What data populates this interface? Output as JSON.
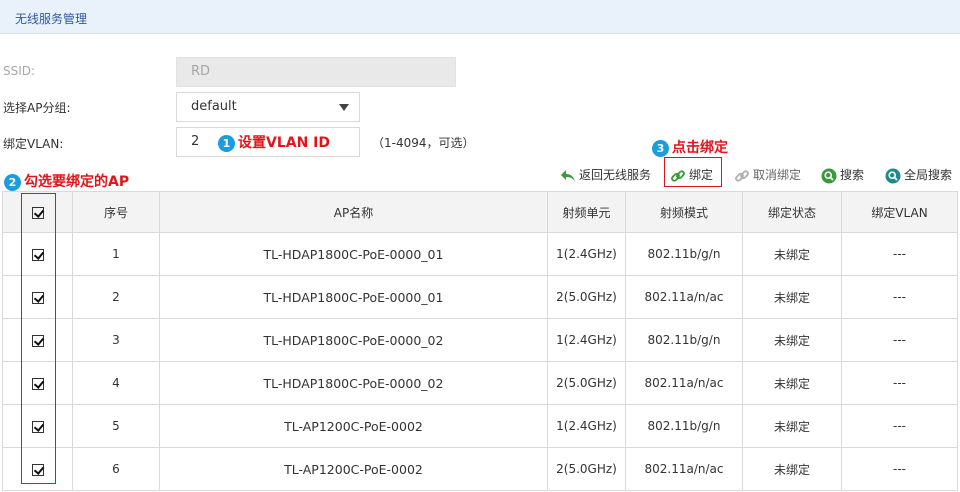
{
  "header": {
    "title": "无线服务管理"
  },
  "form": {
    "ssid": {
      "label": "SSID:",
      "value": "RD"
    },
    "ap_group": {
      "label": "选择AP分组:",
      "value": "default"
    },
    "vlan": {
      "label": "绑定VLAN:",
      "value": "2",
      "hint": "（1-4094，可选）"
    }
  },
  "annotations": {
    "step1": {
      "num": "1",
      "text": "设置VLAN ID"
    },
    "step2": {
      "num": "2",
      "text": "勾选要绑定的AP"
    },
    "step3": {
      "num": "3",
      "text": "点击绑定"
    }
  },
  "toolbar": {
    "back": "返回无线服务",
    "bind": "绑定",
    "unbind": "取消绑定",
    "search": "搜索",
    "global_search": "全局搜索"
  },
  "colors": {
    "annotation": "#e0151b",
    "badge": "#1a9de0",
    "icon_green": "#3a9a3a",
    "title": "#2c5aa0"
  },
  "table": {
    "headers": [
      "序号",
      "AP名称",
      "射频单元",
      "射频模式",
      "绑定状态",
      "绑定VLAN"
    ],
    "rows": [
      {
        "index": "1",
        "name": "TL-HDAP1800C-PoE-0000_01",
        "radio": "1(2.4GHz)",
        "mode": "802.11b/g/n",
        "status": "未绑定",
        "vlan": "---",
        "checked": true
      },
      {
        "index": "2",
        "name": "TL-HDAP1800C-PoE-0000_01",
        "radio": "2(5.0GHz)",
        "mode": "802.11a/n/ac",
        "status": "未绑定",
        "vlan": "---",
        "checked": true
      },
      {
        "index": "3",
        "name": "TL-HDAP1800C-PoE-0000_02",
        "radio": "1(2.4GHz)",
        "mode": "802.11b/g/n",
        "status": "未绑定",
        "vlan": "---",
        "checked": true
      },
      {
        "index": "4",
        "name": "TL-HDAP1800C-PoE-0000_02",
        "radio": "2(5.0GHz)",
        "mode": "802.11a/n/ac",
        "status": "未绑定",
        "vlan": "---",
        "checked": true
      },
      {
        "index": "5",
        "name": "TL-AP1200C-PoE-0002",
        "radio": "1(2.4GHz)",
        "mode": "802.11b/g/n",
        "status": "未绑定",
        "vlan": "---",
        "checked": true
      },
      {
        "index": "6",
        "name": "TL-AP1200C-PoE-0002",
        "radio": "2(5.0GHz)",
        "mode": "802.11a/n/ac",
        "status": "未绑定",
        "vlan": "---",
        "checked": true
      }
    ]
  }
}
